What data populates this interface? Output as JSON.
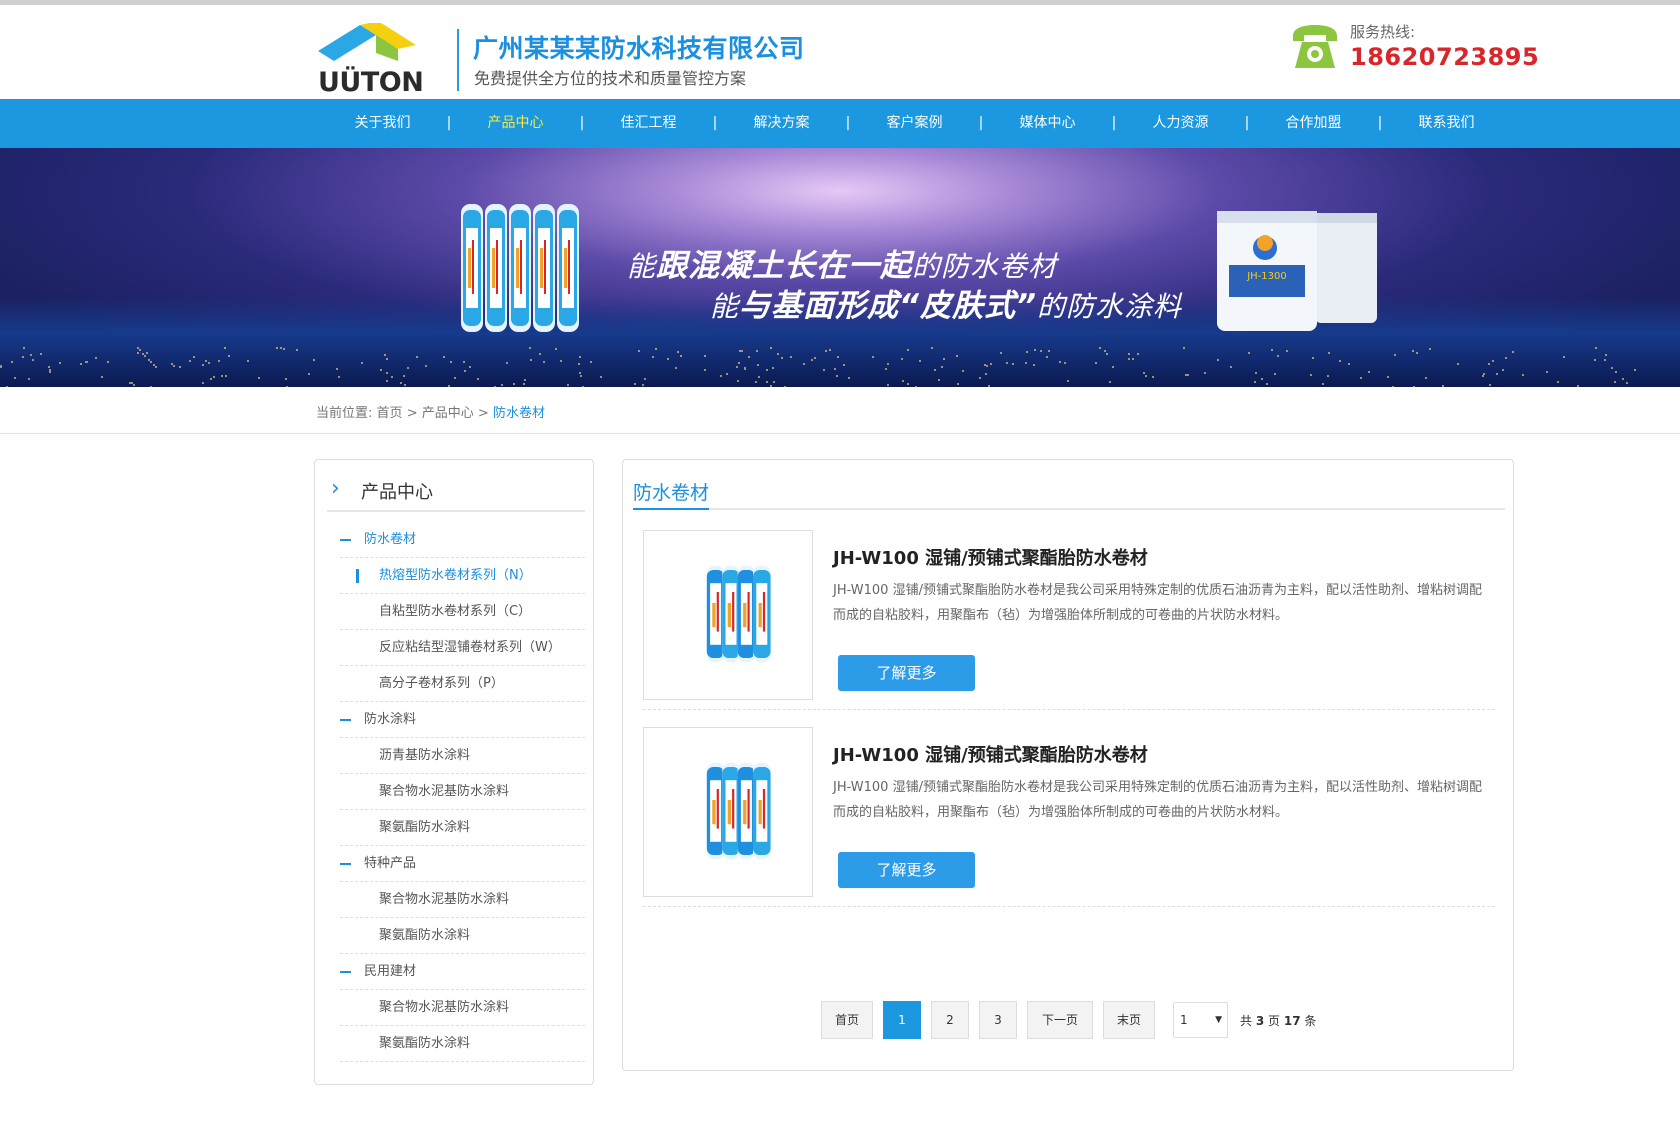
{
  "header": {
    "logo_text": "UÜTON",
    "company_name": "广州某某某防水科技有限公司",
    "slogan": "免费提供全方位的技术和质量管控方案",
    "hotline_label": "服务热线:",
    "hotline_number": "18620723895"
  },
  "nav": {
    "items": [
      {
        "label": "关于我们"
      },
      {
        "label": "产品中心",
        "active": true
      },
      {
        "label": "佳汇工程"
      },
      {
        "label": "解决方案"
      },
      {
        "label": "客户案例"
      },
      {
        "label": "媒体中心"
      },
      {
        "label": "人力资源"
      },
      {
        "label": "合作加盟"
      },
      {
        "label": "联系我们"
      }
    ],
    "separator": "|"
  },
  "banner": {
    "line1_prefix": "能",
    "line1_bold": "跟混凝土长在一起",
    "line1_suffix": "的防水卷材",
    "line2_prefix": "能",
    "line2_bold": "与基面形成“皮肤式”",
    "line2_suffix": "的防水涂料",
    "bucket_label": "JH-1300"
  },
  "breadcrumb": {
    "prefix": "当前位置:",
    "home": "首页",
    "sep": ">",
    "section": "产品中心",
    "current": "防水卷材"
  },
  "sidebar": {
    "title": "产品中心",
    "items": [
      {
        "type": "cat",
        "label": "防水卷材",
        "open": true
      },
      {
        "type": "sub",
        "label": "热熔型防水卷材系列（N）",
        "active": true
      },
      {
        "type": "sub",
        "label": "自粘型防水卷材系列（C）"
      },
      {
        "type": "sub",
        "label": "反应粘结型湿铺卷材系列（W）"
      },
      {
        "type": "sub",
        "label": "高分子卷材系列（P）"
      },
      {
        "type": "cat",
        "label": "防水涂料"
      },
      {
        "type": "sub",
        "label": "沥青基防水涂料"
      },
      {
        "type": "sub",
        "label": "聚合物水泥基防水涂料"
      },
      {
        "type": "sub",
        "label": "聚氨酯防水涂料"
      },
      {
        "type": "cat",
        "label": "特种产品"
      },
      {
        "type": "sub",
        "label": "聚合物水泥基防水涂料"
      },
      {
        "type": "sub",
        "label": "聚氨酯防水涂料"
      },
      {
        "type": "cat",
        "label": "民用建材"
      },
      {
        "type": "sub",
        "label": "聚合物水泥基防水涂料"
      },
      {
        "type": "sub",
        "label": "聚氨酯防水涂料"
      }
    ]
  },
  "main": {
    "title": "防水卷材",
    "products": [
      {
        "name": "JH-W100 湿铺/预铺式聚酯胎防水卷材",
        "desc": "JH-W100 湿铺/预铺式聚酯胎防水卷材是我公司采用特殊定制的优质石油沥青为主料，配以活性助剂、增粘树调配而成的自粘胶料，用聚酯布（毡）为增强胎体所制成的可卷曲的片状防水材料。",
        "button": "了解更多"
      },
      {
        "name": "JH-W100 湿铺/预铺式聚酯胎防水卷材",
        "desc": "JH-W100 湿铺/预铺式聚酯胎防水卷材是我公司采用特殊定制的优质石油沥青为主料，配以活性助剂、增粘树调配而成的自粘胶料，用聚酯布（毡）为增强胎体所制成的可卷曲的片状防水材料。",
        "button": "了解更多"
      }
    ],
    "pager": {
      "first": "首页",
      "pages": [
        "1",
        "2",
        "3"
      ],
      "current_page": "1",
      "next": "下一页",
      "last": "末页",
      "select_value": "1",
      "total_prefix": "共",
      "total_pages": "3",
      "pages_unit": "页",
      "total_items": "17",
      "items_unit": "条"
    }
  },
  "colors": {
    "brand_blue": "#1b98e0",
    "hotline_red": "#d8262a",
    "active_nav": "#ffe73c"
  },
  "icons": [
    "phone-icon",
    "chevron-right-icon",
    "minus-icon",
    "chevron-down-icon"
  ]
}
